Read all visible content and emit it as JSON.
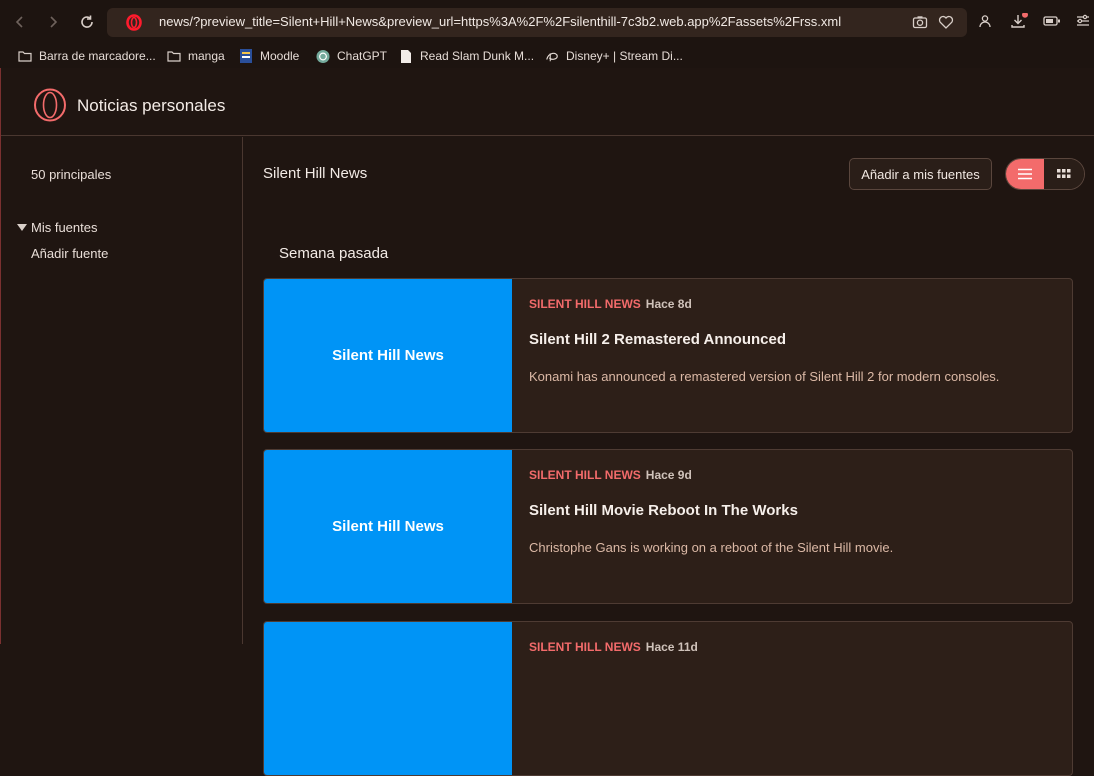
{
  "browser": {
    "url": "news/?preview_title=Silent+Hill+News&preview_url=https%3A%2F%2Fsilenthill-7c3b2.web.app%2Fassets%2Frss.xml",
    "bookmarks": [
      {
        "label": "Barra de marcadore...",
        "icon": "folder-icon"
      },
      {
        "label": "manga",
        "icon": "folder-icon"
      },
      {
        "label": "Moodle",
        "icon": "moodle-icon"
      },
      {
        "label": "ChatGPT",
        "icon": "chatgpt-icon"
      },
      {
        "label": "Read Slam Dunk M...",
        "icon": "page-icon"
      },
      {
        "label": "Disney+ | Stream Di...",
        "icon": "disney-icon"
      }
    ]
  },
  "header": {
    "title": "Noticias personales"
  },
  "sidebar": {
    "top_label": "50 principales",
    "my_sources_label": "Mis fuentes",
    "add_source_label": "Añadir fuente"
  },
  "main": {
    "feed_title": "Silent Hill News",
    "add_button_label": "Añadir a mis fuentes",
    "section_title": "Semana pasada",
    "accent_color": "#f36b6b",
    "thumb_color": "#0094f6",
    "articles": [
      {
        "thumb_label": "Silent Hill News",
        "source": "SILENT HILL NEWS",
        "age": "Hace 8d",
        "title": "Silent Hill 2 Remastered Announced",
        "description": "Konami has announced a remastered version of Silent Hill 2 for modern consoles."
      },
      {
        "thumb_label": "Silent Hill News",
        "source": "SILENT HILL NEWS",
        "age": "Hace 9d",
        "title": "Silent Hill Movie Reboot In The Works",
        "description": "Christophe Gans is working on a reboot of the Silent Hill movie."
      },
      {
        "thumb_label": "",
        "source": "SILENT HILL NEWS",
        "age": "Hace 11d",
        "title": "",
        "description": ""
      }
    ]
  }
}
